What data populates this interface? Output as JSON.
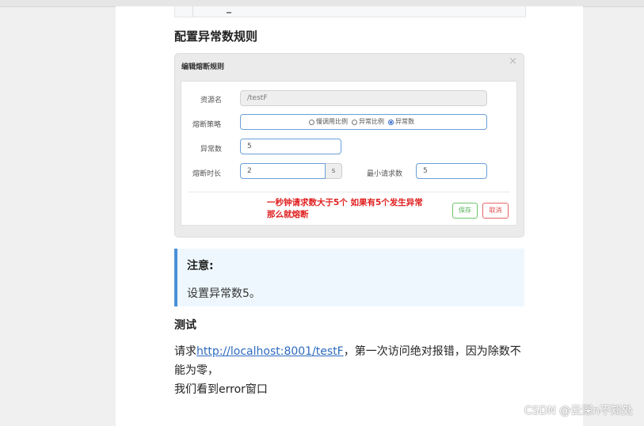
{
  "article": {
    "heading_rules": "配置异常数规则",
    "modal": {
      "title": "编辑熔断规则",
      "close": "×",
      "resource_label": "资源名",
      "resource_value": "/testF",
      "strategy_label": "熔断策略",
      "strategy_options": [
        "慢调用比例",
        "异常比例",
        "异常数"
      ],
      "strategy_selected": "异常数",
      "exception_count_label": "异常数",
      "exception_count_value": "5",
      "duration_label": "熔断时长",
      "duration_value": "2",
      "duration_unit": "s",
      "min_requests_label": "最小请求数",
      "min_requests_value": "5",
      "annotation_line1": "一秒钟请求数大于5个 如果有5个发生异常",
      "annotation_line2": "那么就熔断",
      "save_label": "保存",
      "cancel_label": "取消"
    },
    "note": {
      "title": "注意:",
      "text": "设置异常数5。"
    },
    "heading_test": "测试",
    "para": {
      "prefix": "请求",
      "link": "http://localhost:8001/testF",
      "suffix": "，第一次访问绝对报错，因为除数不能为零，",
      "line2": "我们看到error窗口"
    }
  },
  "watermark": "CSDN @云深n不知处",
  "colors": {
    "annotation": "#e02020",
    "accent": "#4a90d9",
    "save": "#4caf50",
    "cancel": "#e04848"
  }
}
